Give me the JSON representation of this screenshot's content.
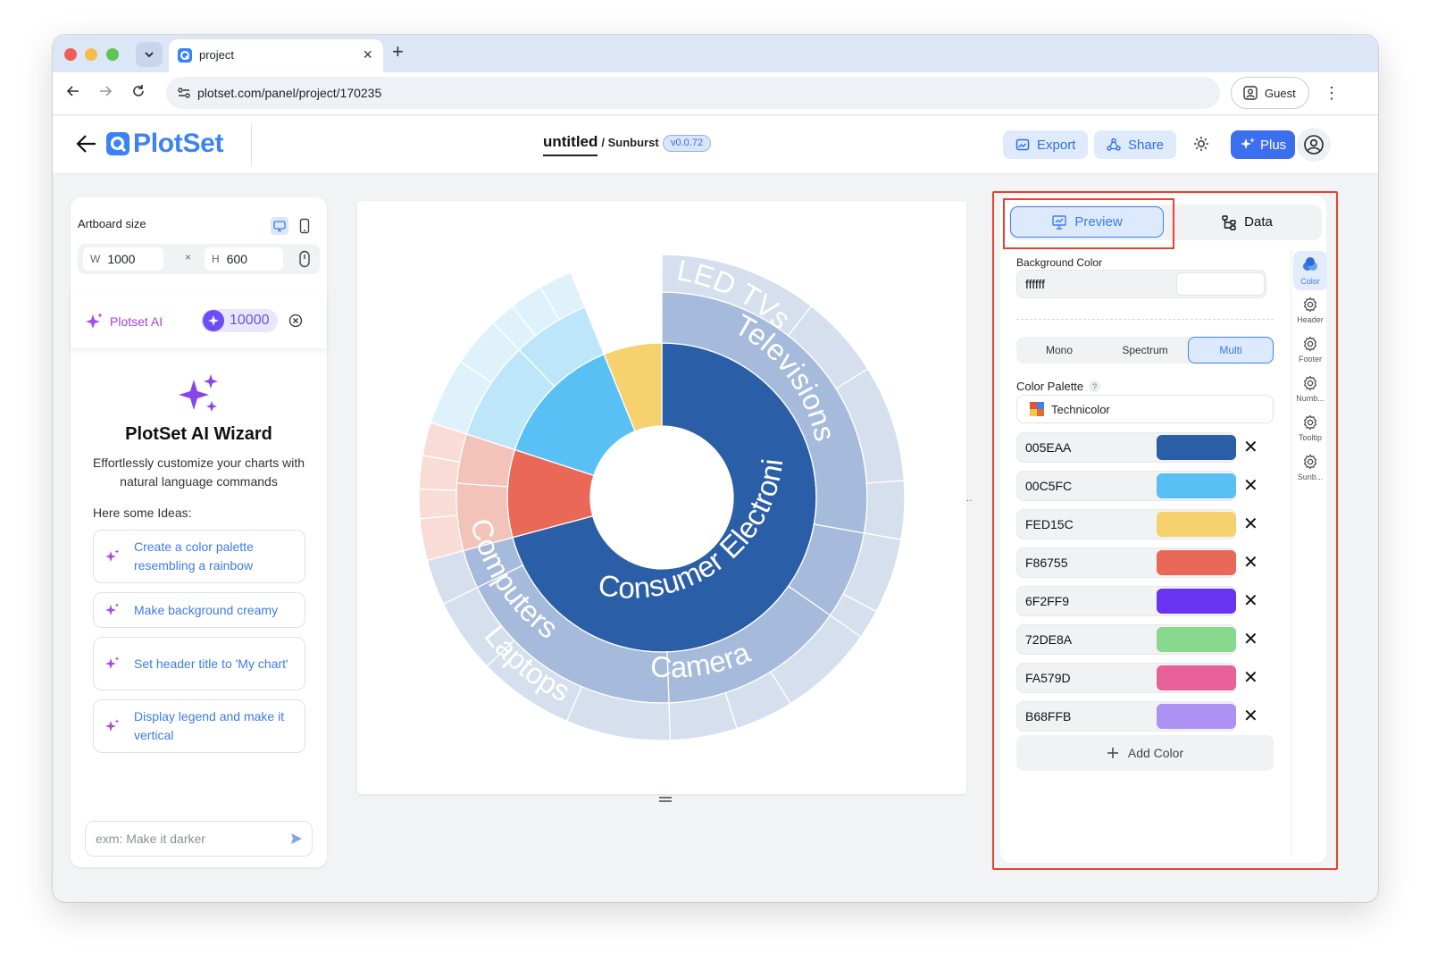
{
  "browser": {
    "tab_title": "project",
    "url": "plotset.com/panel/project/170235",
    "guest_label": "Guest"
  },
  "app": {
    "logo_text": "PlotSet",
    "project_name": "untitled",
    "chart_type": "/ Sunburst",
    "version": "v0.0.72",
    "export_label": "Export",
    "share_label": "Share",
    "plus_label": "Plus"
  },
  "left_panel": {
    "artboard_label": "Artboard size",
    "width_label": "W",
    "width_value": "1000",
    "times": "×",
    "height_label": "H",
    "height_value": "600",
    "ai_name": "Plotset AI",
    "credits": "10000",
    "wizard_title": "PlotSet AI Wizard",
    "wizard_sub": "Effortlessly customize your charts with natural language commands",
    "ideas_label": "Here some Ideas:",
    "ideas": [
      "Create a color palette resembling a rainbow",
      "Make background creamy",
      "Set header title to 'My chart'",
      "Display legend and make it vertical"
    ],
    "prompt_placeholder": "exm: Make it darker"
  },
  "chart_data": {
    "type": "sunburst",
    "title": "",
    "labels": [
      "Consumer Electronics",
      "Televisions",
      "Computers",
      "Cameras",
      "LED TVs",
      "Laptops"
    ],
    "colors": {
      "primary": "#005EAA",
      "secondary": "#00C5FC",
      "tertiary": "#FED15C",
      "quaternary": "#F86755"
    }
  },
  "right_panel": {
    "preview_label": "Preview",
    "data_label": "Data",
    "bg_label": "Background Color",
    "bg_value": "ffffff",
    "modes": [
      "Mono",
      "Spectrum",
      "Multi"
    ],
    "active_mode": "Multi",
    "palette_label": "Color Palette",
    "palette_help": "?",
    "palette_name": "Technicolor",
    "colors": [
      {
        "hex": "005EAA",
        "swatch": "#2a5ea6"
      },
      {
        "hex": "00C5FC",
        "swatch": "#59c0f6"
      },
      {
        "hex": "FED15C",
        "swatch": "#f6d16e"
      },
      {
        "hex": "F86755",
        "swatch": "#ea6857"
      },
      {
        "hex": "6F2FF9",
        "swatch": "#6a33f2"
      },
      {
        "hex": "72DE8A",
        "swatch": "#86d98d"
      },
      {
        "hex": "FA579D",
        "swatch": "#e8609a"
      },
      {
        "hex": "B68FFB",
        "swatch": "#ad91f3"
      }
    ],
    "remove_glyph": "✕",
    "add_color_label": "Add Color",
    "sidebar": [
      "Color",
      "Header",
      "Footer",
      "Numb...",
      "Tooltip",
      "Sunb..."
    ]
  }
}
